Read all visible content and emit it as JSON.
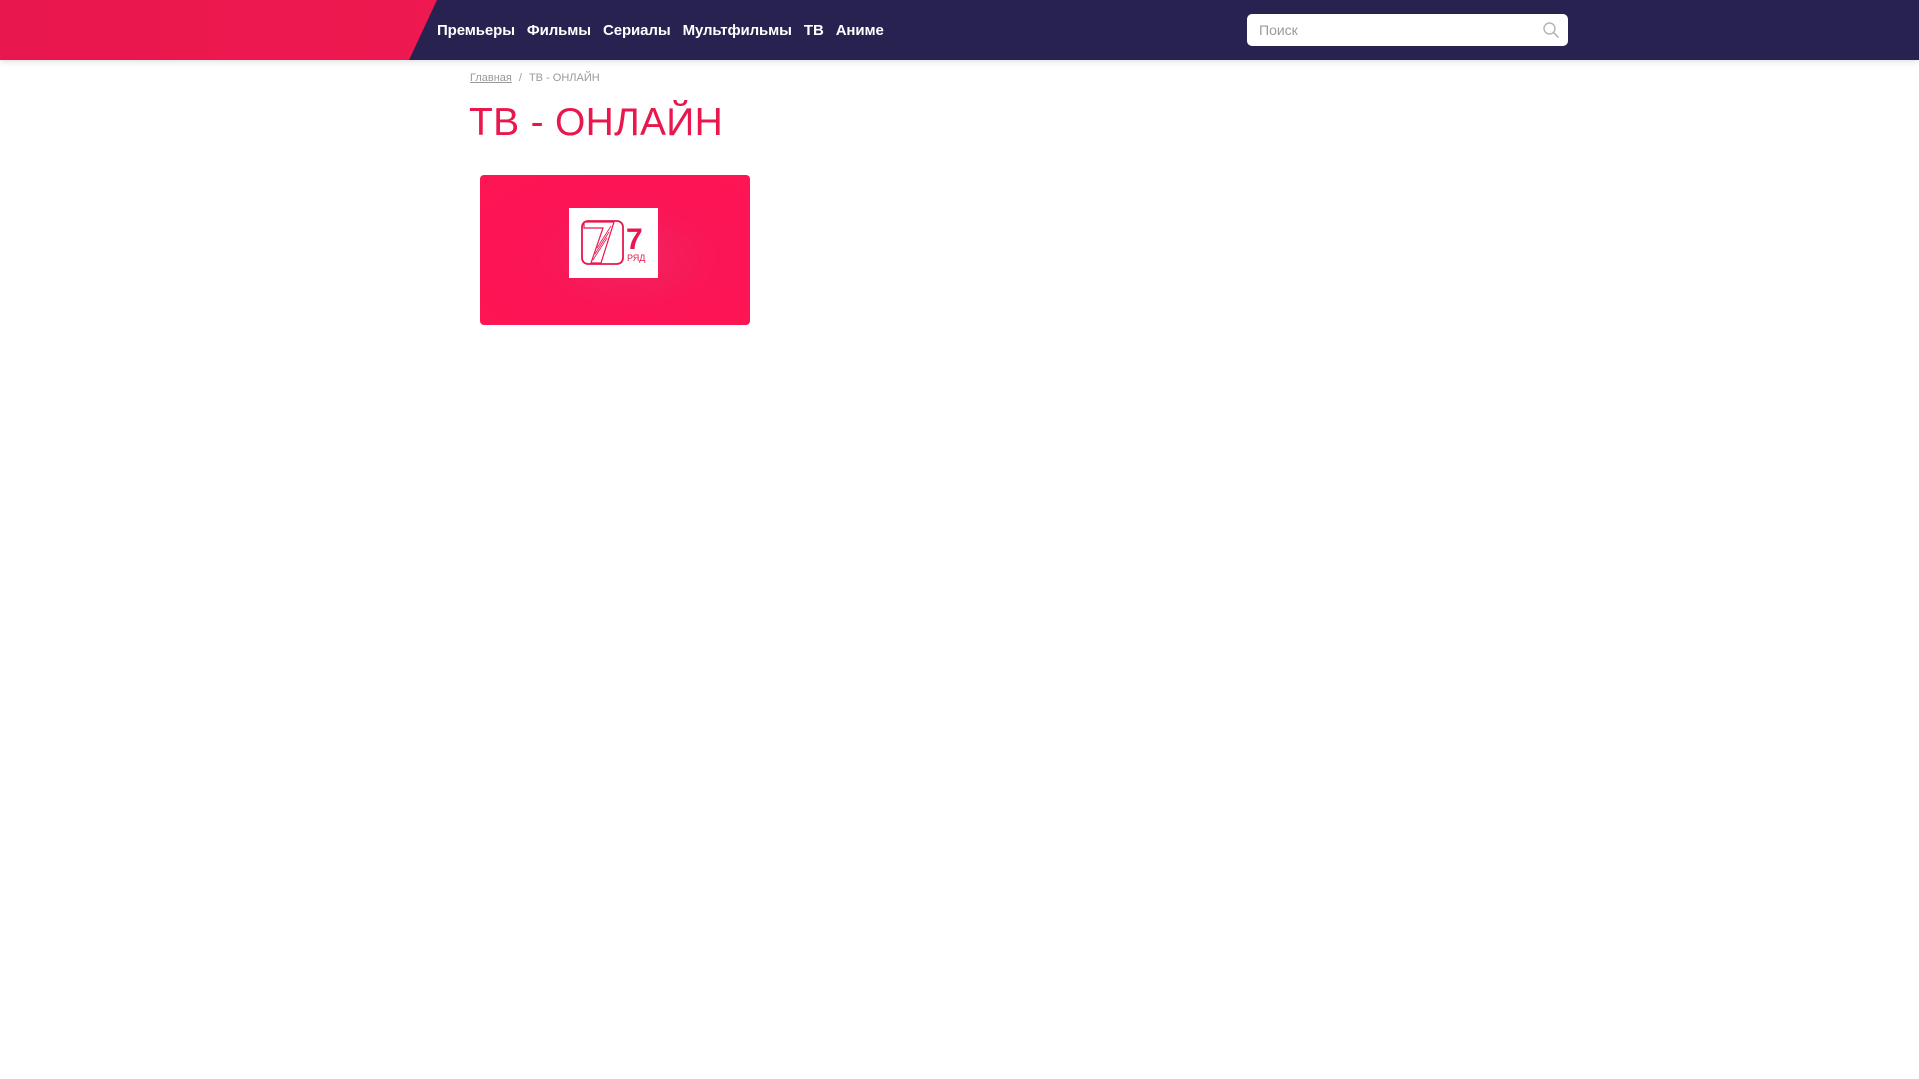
{
  "header": {
    "nav": [
      {
        "label": "Премьеры"
      },
      {
        "label": "Фильмы"
      },
      {
        "label": "Сериалы"
      },
      {
        "label": "Мультфильмы"
      },
      {
        "label": "ТВ"
      },
      {
        "label": "Аниме"
      }
    ],
    "search": {
      "placeholder": "Поиск",
      "icon": "search-icon"
    }
  },
  "breadcrumb": {
    "home": "Главная",
    "separator": "/",
    "current": "ТВ - ОНЛАЙН"
  },
  "page": {
    "title": "ТВ - ОНЛАЙН"
  },
  "channels": [
    {
      "logo_number": "7",
      "logo_caption": "РЯД",
      "logo_name": "7-ryad-logo"
    }
  ],
  "colors": {
    "header_bg": "#272250",
    "accent": "#e8174d",
    "card_bg": "#ff1553"
  }
}
